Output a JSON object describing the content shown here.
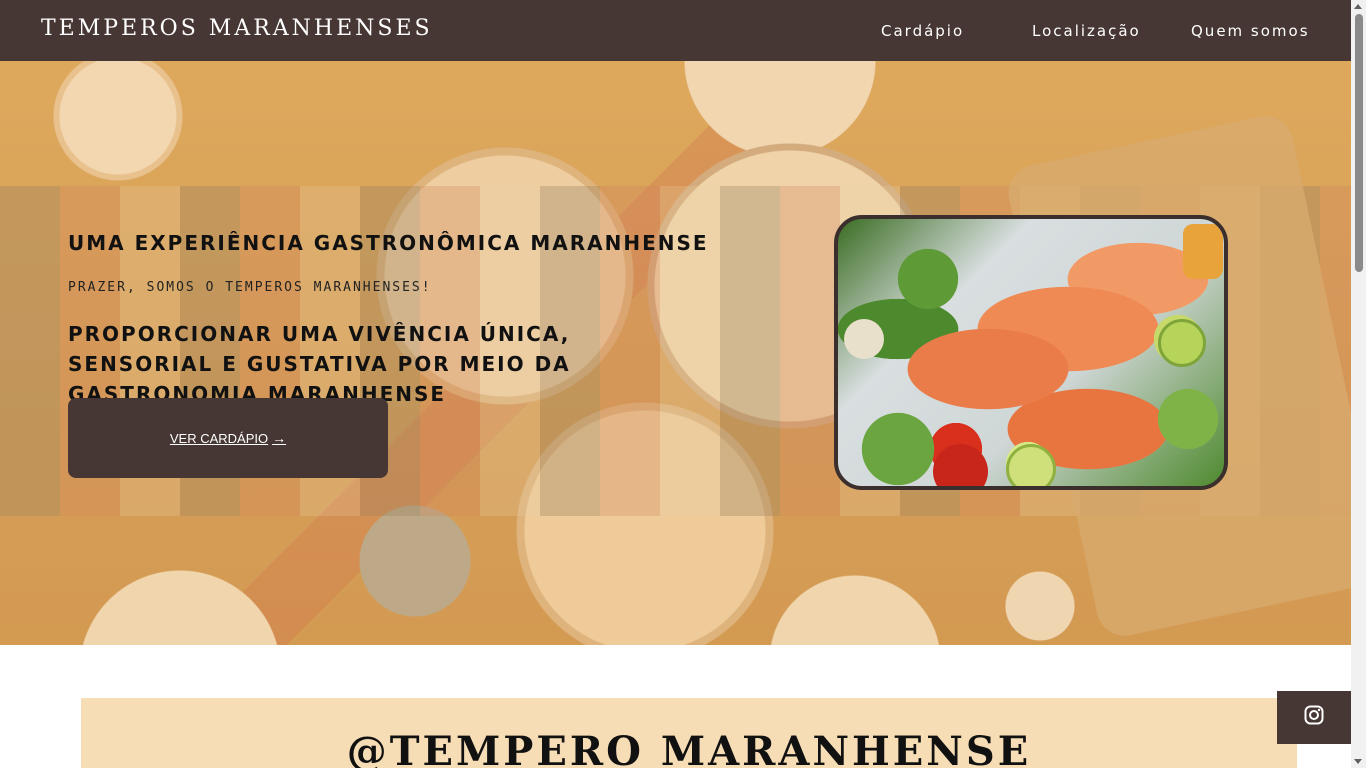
{
  "navbar": {
    "brand": "TEMPEROS MARANHENSES",
    "links": [
      "Cardápio",
      "Localização",
      "Quem somos"
    ]
  },
  "hero": {
    "title": "UMA EXPERIÊNCIA GASTRONÔMICA MARANHENSE",
    "subtitle": "PRAZER, SOMOS O TEMPEROS MARANHENSES!",
    "description": "PROPORCIONAR UMA VIVÊNCIA ÚNICA, SENSORIAL E GUSTATIVA POR MEIO DA GASTRONOMIA MARANHENSE",
    "cta_label": "VER CARDÁPIO",
    "cta_arrow": "→"
  },
  "instagram": {
    "handle": "@TEMPERO MARANHENSE"
  },
  "icons": {
    "cta": "arrow-right-icon",
    "float": "instagram-icon"
  },
  "colors": {
    "nav_bg": "#463734",
    "button_bg": "#463734",
    "insta_section_bg": "#f7ddb5"
  }
}
